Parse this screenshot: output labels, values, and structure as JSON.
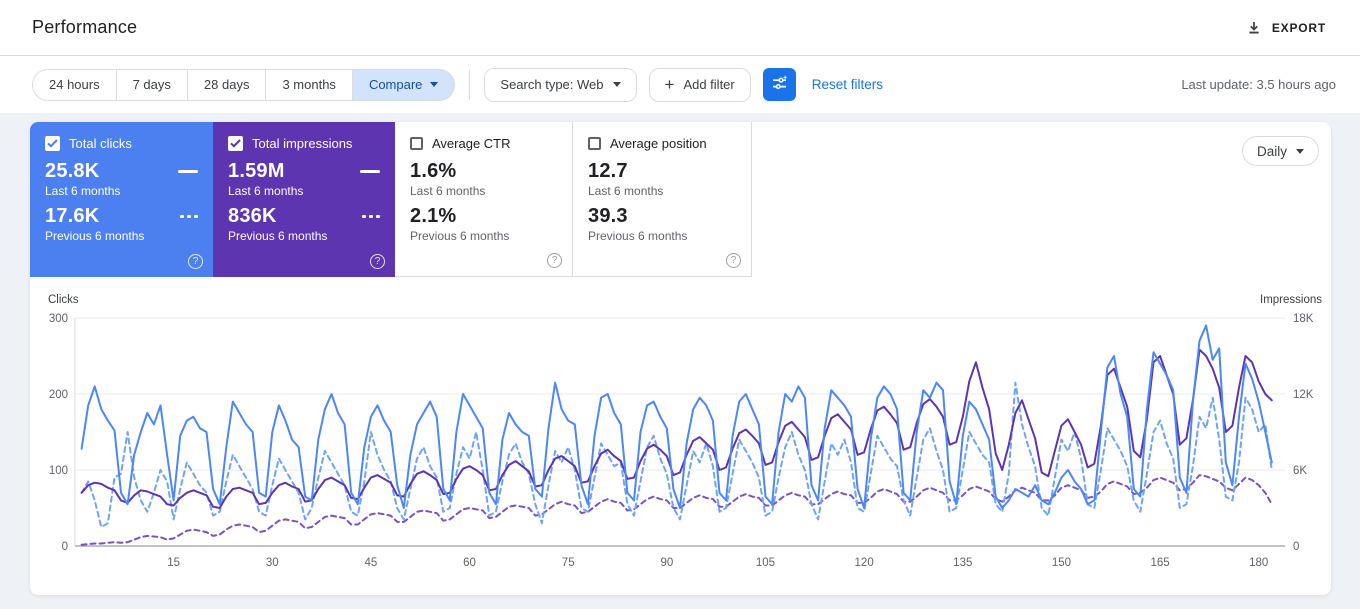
{
  "header": {
    "title": "Performance",
    "export_label": "EXPORT"
  },
  "filters": {
    "date_tabs": [
      "24 hours",
      "7 days",
      "28 days",
      "3 months"
    ],
    "compare_label": "Compare",
    "search_type_label": "Search type: Web",
    "add_filter_label": "Add filter",
    "reset_label": "Reset filters",
    "last_update": "Last update: 3.5 hours ago"
  },
  "cards": [
    {
      "label": "Total clicks",
      "checked": true,
      "color": "#4c80f1",
      "value1": "25.8K",
      "caption1": "Last 6 months",
      "value2": "17.6K",
      "caption2": "Previous 6 months"
    },
    {
      "label": "Total impressions",
      "checked": true,
      "color": "#5e35b1",
      "value1": "1.59M",
      "caption1": "Last 6 months",
      "value2": "836K",
      "caption2": "Previous 6 months"
    },
    {
      "label": "Average CTR",
      "checked": false,
      "value1": "1.6%",
      "caption1": "Last 6 months",
      "value2": "2.1%",
      "caption2": "Previous 6 months"
    },
    {
      "label": "Average position",
      "checked": false,
      "value1": "12.7",
      "caption1": "Last 6 months",
      "value2": "39.3",
      "caption2": "Previous 6 months"
    }
  ],
  "granularity": {
    "label": "Daily"
  },
  "chart_data": {
    "type": "line",
    "axis_left_label": "Clicks",
    "axis_right_label": "Impressions",
    "y_left": {
      "ticks": [
        "0",
        "100",
        "200",
        "300"
      ],
      "max": 300
    },
    "y_right": {
      "ticks": [
        "0",
        "6K",
        "12K",
        "18K"
      ],
      "max": 18000
    },
    "x_axis": {
      "ticks": [
        15,
        30,
        45,
        60,
        75,
        90,
        105,
        120,
        135,
        150,
        165,
        180
      ],
      "days": 184
    },
    "series": [
      {
        "name": "Impressions - Previous 6 months",
        "axis": "right",
        "style": "dashed",
        "color": "#7a52c7",
        "values": [
          100,
          150,
          200,
          200,
          250,
          300,
          250,
          300,
          500,
          700,
          800,
          750,
          700,
          500,
          600,
          900,
          1200,
          1300,
          1200,
          1100,
          800,
          900,
          1300,
          1600,
          1700,
          1600,
          1500,
          1100,
          1200,
          1600,
          2000,
          2100,
          2000,
          1900,
          1400,
          1500,
          1900,
          2300,
          2400,
          2300,
          2200,
          1700,
          1700,
          2100,
          2500,
          2600,
          2500,
          2400,
          1900,
          1900,
          2300,
          2700,
          2800,
          2700,
          2600,
          2000,
          2100,
          2500,
          2900,
          3000,
          2900,
          2800,
          2200,
          2300,
          2700,
          3100,
          3200,
          3100,
          3000,
          2400,
          2500,
          2900,
          3300,
          3500,
          3300,
          3200,
          2600,
          2700,
          3100,
          3500,
          3700,
          3500,
          3400,
          2800,
          2900,
          3300,
          3700,
          3900,
          3700,
          3600,
          3000,
          3000,
          3400,
          3800,
          4000,
          3800,
          3700,
          3100,
          3100,
          3500,
          3900,
          4100,
          3900,
          3800,
          3200,
          3200,
          3600,
          4000,
          4200,
          4000,
          3900,
          3300,
          3300,
          3700,
          4100,
          4300,
          4100,
          4000,
          3400,
          3400,
          3800,
          4300,
          4500,
          4300,
          4100,
          3500,
          3500,
          3900,
          4400,
          4600,
          4400,
          4200,
          3600,
          3600,
          4000,
          4500,
          4700,
          4500,
          4300,
          3700,
          3500,
          3900,
          4400,
          4600,
          4400,
          4200,
          3600,
          3600,
          4000,
          4600,
          4800,
          4600,
          4400,
          3800,
          3900,
          4300,
          4900,
          5100,
          4900,
          4700,
          4100,
          4200,
          4600,
          5200,
          5400,
          5200,
          5000,
          4400,
          4500,
          5000,
          5600,
          5500,
          5300,
          5100,
          4600,
          4400,
          4900,
          5400,
          5200,
          4800,
          4200,
          3300
        ]
      },
      {
        "name": "Clicks - Previous 6 months",
        "axis": "left",
        "style": "dashed",
        "color": "#6fa3f8",
        "values": [
          70,
          85,
          60,
          25,
          30,
          90,
          95,
          150,
          90,
          60,
          45,
          70,
          100,
          85,
          35,
          75,
          110,
          95,
          80,
          70,
          40,
          45,
          85,
          120,
          105,
          90,
          75,
          45,
          40,
          80,
          115,
          100,
          85,
          70,
          35,
          50,
          90,
          125,
          110,
          95,
          80,
          45,
          40,
          85,
          150,
          120,
          100,
          85,
          50,
          35,
          75,
          115,
          130,
          105,
          90,
          45,
          50,
          95,
          130,
          115,
          150,
          100,
          40,
          45,
          85,
          120,
          135,
          110,
          95,
          55,
          30,
          80,
          125,
          110,
          130,
          100,
          50,
          45,
          90,
          135,
          120,
          105,
          110,
          55,
          40,
          85,
          130,
          145,
          115,
          95,
          50,
          35,
          80,
          125,
          110,
          135,
          105,
          45,
          50,
          95,
          140,
          125,
          110,
          90,
          40,
          45,
          90,
          130,
          150,
          120,
          100,
          55,
          35,
          85,
          135,
          120,
          140,
          110,
          50,
          45,
          95,
          145,
          130,
          115,
          105,
          60,
          40,
          90,
          140,
          155,
          125,
          100,
          45,
          50,
          100,
          150,
          135,
          120,
          110,
          55,
          45,
          95,
          215,
          160,
          130,
          105,
          50,
          40,
          90,
          140,
          125,
          150,
          115,
          55,
          50,
          100,
          155,
          140,
          125,
          105,
          60,
          45,
          95,
          150,
          165,
          135,
          115,
          50,
          55,
          105,
          170,
          155,
          195,
          140,
          65,
          60,
          110,
          195,
          180,
          150,
          160,
          100
        ]
      },
      {
        "name": "Impressions - Last 6 months",
        "axis": "right",
        "style": "solid",
        "color": "#5e35b1",
        "values": [
          4200,
          4800,
          5000,
          4900,
          4600,
          4400,
          3600,
          3400,
          4000,
          4400,
          4300,
          4100,
          3900,
          3300,
          3200,
          3800,
          4200,
          4400,
          4200,
          4000,
          3100,
          3000,
          3900,
          4500,
          4600,
          4400,
          4200,
          3300,
          3400,
          4200,
          4800,
          5000,
          4700,
          4500,
          3500,
          3600,
          4500,
          5200,
          5400,
          5100,
          4800,
          3800,
          3700,
          4600,
          5400,
          5600,
          5300,
          5000,
          4000,
          3900,
          4900,
          5700,
          5900,
          5600,
          5200,
          4100,
          4200,
          5300,
          6100,
          6300,
          6000,
          5600,
          4400,
          4500,
          5600,
          6400,
          6700,
          6300,
          5900,
          4700,
          4800,
          6000,
          6900,
          7100,
          6700,
          6300,
          5000,
          5100,
          6300,
          7300,
          7600,
          7100,
          6700,
          5300,
          5400,
          6700,
          7700,
          8000,
          7600,
          7100,
          5600,
          5800,
          7200,
          8300,
          8600,
          8100,
          7600,
          6000,
          6200,
          7700,
          8900,
          9200,
          8700,
          8100,
          6400,
          6600,
          8200,
          9500,
          9800,
          9200,
          8600,
          6800,
          7000,
          8700,
          10100,
          10400,
          9800,
          9200,
          7200,
          7400,
          9200,
          10700,
          11000,
          10400,
          9700,
          7600,
          7800,
          9700,
          11200,
          11600,
          11000,
          10200,
          8000,
          8200,
          10200,
          13000,
          14500,
          12500,
          10800,
          7300,
          6000,
          8000,
          10500,
          11500,
          10000,
          8500,
          5800,
          5500,
          7500,
          9500,
          10000,
          9000,
          8000,
          6200,
          6500,
          9500,
          13500,
          14000,
          12500,
          11000,
          7500,
          7000,
          10000,
          14500,
          15000,
          13500,
          12000,
          8000,
          8500,
          11500,
          15500,
          15000,
          14000,
          12500,
          9000,
          9500,
          12500,
          15000,
          14500,
          13000,
          12000,
          11500
        ]
      },
      {
        "name": "Clicks - Last 6 months",
        "axis": "left",
        "style": "solid",
        "color": "#4b87f5",
        "values": [
          128,
          185,
          210,
          180,
          165,
          152,
          70,
          55,
          120,
          150,
          175,
          160,
          185,
          120,
          60,
          145,
          165,
          170,
          155,
          150,
          75,
          55,
          130,
          190,
          175,
          160,
          150,
          70,
          65,
          150,
          185,
          165,
          140,
          130,
          65,
          60,
          140,
          180,
          200,
          175,
          160,
          70,
          55,
          130,
          170,
          185,
          165,
          150,
          80,
          50,
          120,
          160,
          175,
          190,
          170,
          75,
          60,
          150,
          200,
          185,
          170,
          155,
          70,
          55,
          140,
          175,
          160,
          150,
          145,
          75,
          65,
          155,
          215,
          180,
          165,
          160,
          80,
          55,
          145,
          195,
          200,
          175,
          160,
          70,
          60,
          150,
          185,
          190,
          170,
          155,
          75,
          50,
          135,
          180,
          195,
          185,
          165,
          70,
          60,
          145,
          190,
          200,
          180,
          160,
          65,
          55,
          150,
          200,
          190,
          210,
          195,
          80,
          60,
          155,
          205,
          195,
          185,
          170,
          75,
          50,
          140,
          195,
          210,
          200,
          180,
          70,
          60,
          150,
          205,
          195,
          215,
          205,
          85,
          55,
          145,
          190,
          180,
          160,
          140,
          65,
          50,
          60,
          75,
          70,
          65,
          80,
          60,
          55,
          70,
          90,
          100,
          85,
          75,
          55,
          60,
          150,
          235,
          250,
          200,
          170,
          75,
          65,
          180,
          255,
          240,
          225,
          205,
          90,
          70,
          190,
          270,
          290,
          245,
          260,
          110,
          80,
          170,
          240,
          220,
          190,
          150,
          110
        ]
      }
    ]
  }
}
